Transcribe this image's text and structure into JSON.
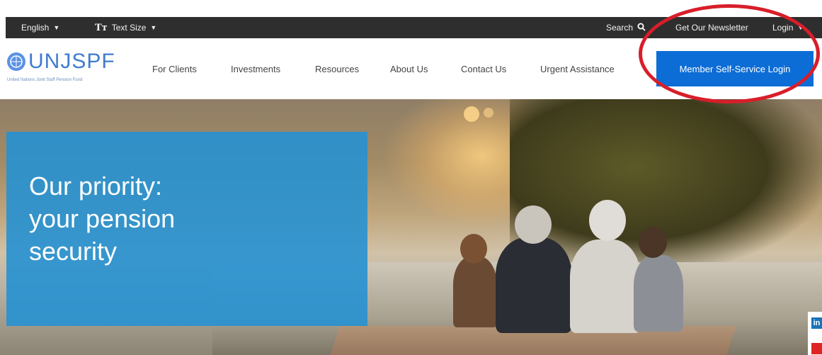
{
  "topbar": {
    "language": "English",
    "text_size": "Text Size",
    "search": "Search",
    "newsletter": "Get Our Newsletter",
    "login": "Login"
  },
  "brand": {
    "name": "UNJSPF",
    "subtitle": "United Nations Joint Staff Pension Fund"
  },
  "nav": {
    "items": [
      {
        "label": "For Clients"
      },
      {
        "label": "Investments"
      },
      {
        "label": "Resources"
      },
      {
        "label": "About Us"
      },
      {
        "label": "Contact Us"
      },
      {
        "label": "Urgent Assistance"
      }
    ],
    "cta": "Member Self-Service Login"
  },
  "hero": {
    "headline": "Our priority:\nyour pension\nsecurity"
  },
  "social": {
    "linkedin": "in"
  },
  "colors": {
    "topbar_bg": "#2e2e2e",
    "brand_blue": "#3f7cd0",
    "cta_blue": "#0d6dd6",
    "hero_box": "#2691d2",
    "highlight_red": "#d81e2a"
  }
}
